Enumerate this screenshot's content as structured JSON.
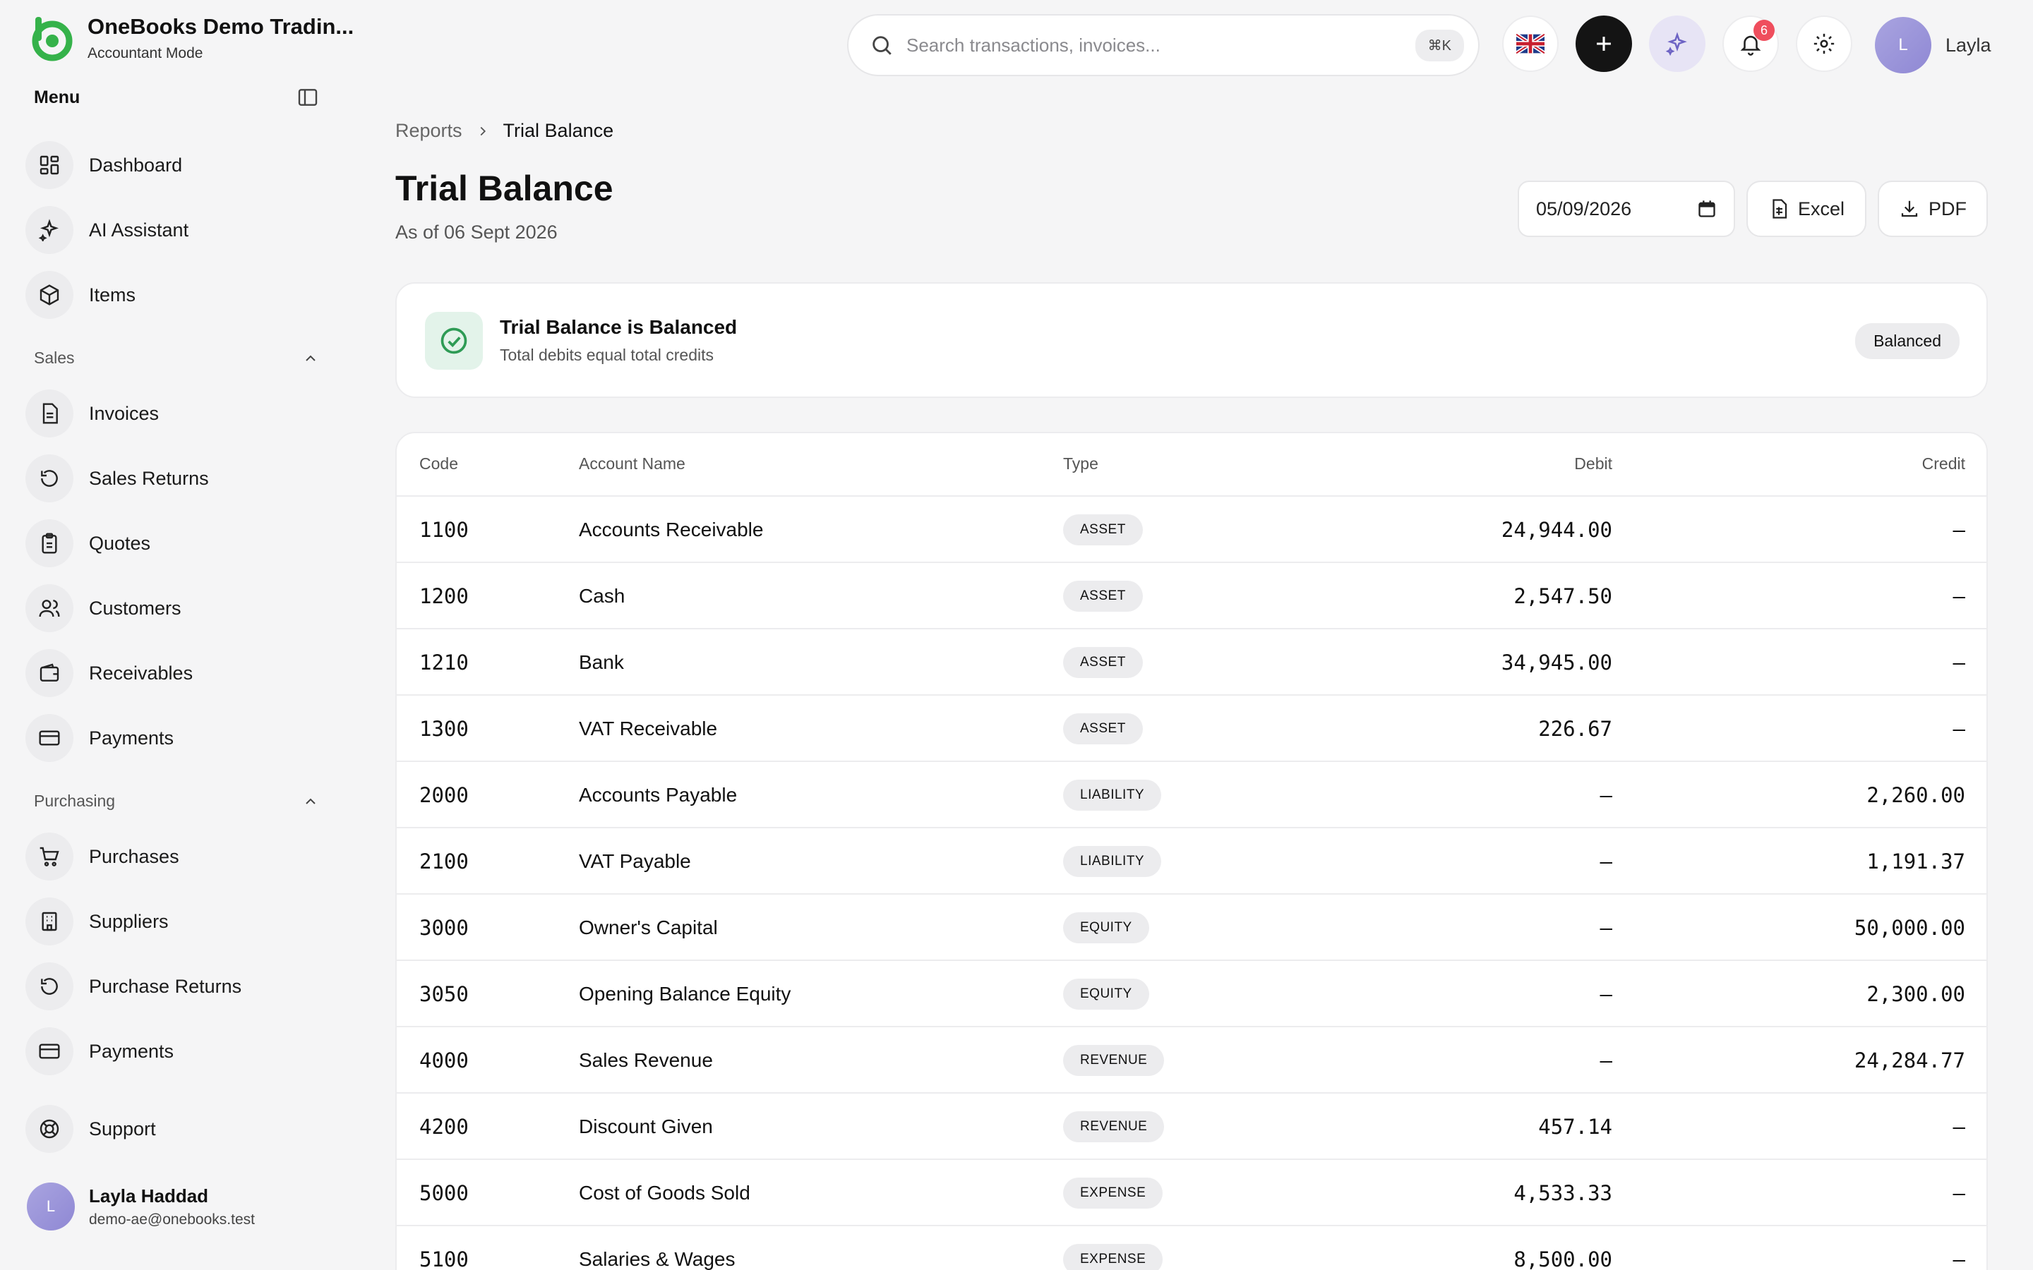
{
  "brand": {
    "name": "OneBooks Demo Tradin...",
    "mode": "Accountant Mode"
  },
  "sidebar": {
    "menu_title": "Menu",
    "top_items": [
      {
        "label": "Dashboard",
        "icon": "dashboard-icon"
      },
      {
        "label": "AI Assistant",
        "icon": "sparkle-icon"
      },
      {
        "label": "Items",
        "icon": "box-icon"
      }
    ],
    "sales": {
      "label": "Sales",
      "items": [
        {
          "label": "Invoices",
          "icon": "document-icon"
        },
        {
          "label": "Sales Returns",
          "icon": "return-icon"
        },
        {
          "label": "Quotes",
          "icon": "clipboard-icon"
        },
        {
          "label": "Customers",
          "icon": "users-icon"
        },
        {
          "label": "Receivables",
          "icon": "wallet-icon"
        },
        {
          "label": "Payments",
          "icon": "card-icon"
        }
      ]
    },
    "purchasing": {
      "label": "Purchasing",
      "items": [
        {
          "label": "Purchases",
          "icon": "cart-icon"
        },
        {
          "label": "Suppliers",
          "icon": "building-icon"
        },
        {
          "label": "Purchase Returns",
          "icon": "return-icon"
        },
        {
          "label": "Payments",
          "icon": "card-icon"
        }
      ]
    },
    "support": {
      "label": "Support",
      "icon": "lifebuoy-icon"
    },
    "user": {
      "initial": "L",
      "name": "Layla Haddad",
      "email": "demo-ae@onebooks.test"
    }
  },
  "topbar": {
    "search_placeholder": "Search transactions, invoices...",
    "shortcut": "⌘K",
    "notification_count": "6",
    "user_initial": "L",
    "user_name": "Layla"
  },
  "breadcrumb": {
    "parent": "Reports",
    "current": "Trial Balance"
  },
  "page": {
    "title": "Trial Balance",
    "subtitle": "As of 06 Sept 2026"
  },
  "controls": {
    "date": "05/09/2026",
    "excel_label": "Excel",
    "pdf_label": "PDF"
  },
  "status": {
    "title": "Trial Balance is Balanced",
    "subtitle": "Total debits equal total credits",
    "badge": "Balanced"
  },
  "table": {
    "headers": {
      "code": "Code",
      "name": "Account Name",
      "type": "Type",
      "debit": "Debit",
      "credit": "Credit"
    },
    "rows": [
      {
        "code": "1100",
        "name": "Accounts Receivable",
        "type": "ASSET",
        "debit": "24,944.00",
        "credit": "–"
      },
      {
        "code": "1200",
        "name": "Cash",
        "type": "ASSET",
        "debit": "2,547.50",
        "credit": "–"
      },
      {
        "code": "1210",
        "name": "Bank",
        "type": "ASSET",
        "debit": "34,945.00",
        "credit": "–"
      },
      {
        "code": "1300",
        "name": "VAT Receivable",
        "type": "ASSET",
        "debit": "226.67",
        "credit": "–"
      },
      {
        "code": "2000",
        "name": "Accounts Payable",
        "type": "LIABILITY",
        "debit": "–",
        "credit": "2,260.00"
      },
      {
        "code": "2100",
        "name": "VAT Payable",
        "type": "LIABILITY",
        "debit": "–",
        "credit": "1,191.37"
      },
      {
        "code": "3000",
        "name": "Owner's Capital",
        "type": "EQUITY",
        "debit": "–",
        "credit": "50,000.00"
      },
      {
        "code": "3050",
        "name": "Opening Balance Equity",
        "type": "EQUITY",
        "debit": "–",
        "credit": "2,300.00"
      },
      {
        "code": "4000",
        "name": "Sales Revenue",
        "type": "REVENUE",
        "debit": "–",
        "credit": "24,284.77"
      },
      {
        "code": "4200",
        "name": "Discount Given",
        "type": "REVENUE",
        "debit": "457.14",
        "credit": "–"
      },
      {
        "code": "5000",
        "name": "Cost of Goods Sold",
        "type": "EXPENSE",
        "debit": "4,533.33",
        "credit": "–"
      },
      {
        "code": "5100",
        "name": "Salaries & Wages",
        "type": "EXPENSE",
        "debit": "8,500.00",
        "credit": "–"
      }
    ]
  },
  "colors": {
    "accent_green": "#35b24a",
    "badge_red": "#ef4e5d",
    "avatar_lavender": "#9d97da"
  }
}
